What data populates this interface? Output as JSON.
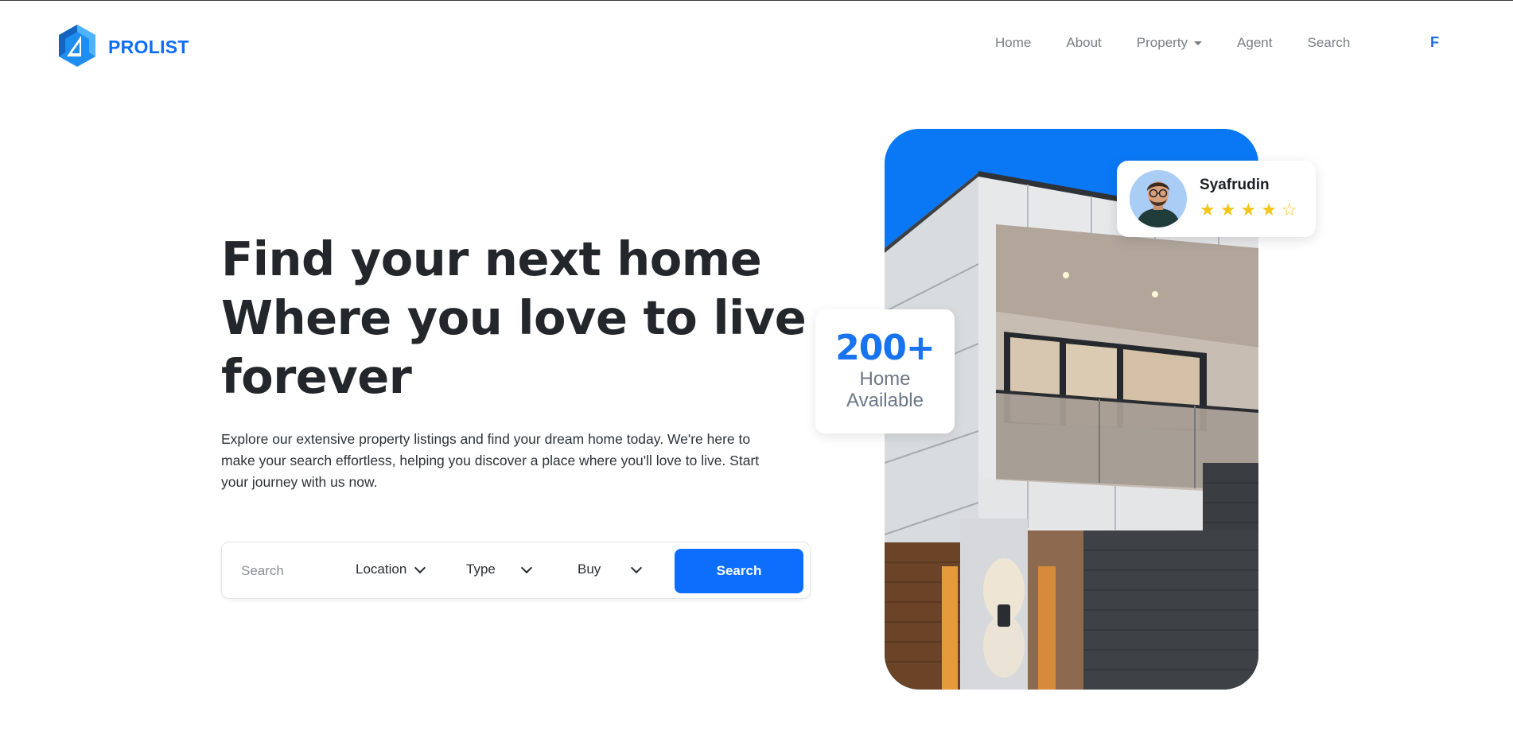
{
  "brand": {
    "name": "PROLIST",
    "logo_icon": "cube-logo-icon",
    "accent": "#0d6efd"
  },
  "nav": {
    "items": [
      "Home",
      "About",
      "Property",
      "Agent",
      "Search"
    ],
    "extra": "F"
  },
  "hero": {
    "title_lines": [
      "Find your next home",
      "Where you love to live",
      "forever"
    ],
    "description": "Explore our extensive property listings and find your dream home today. We're here to make your search effortless, helping you discover a place where you'll love to live. Start your journey with us now."
  },
  "search": {
    "placeholder": "Search",
    "location_label": "Location",
    "type_label": "Type",
    "buy_label": "Buy",
    "button_label": "Search"
  },
  "stat": {
    "value": "200+",
    "label_line1": "Home",
    "label_line2": "Available"
  },
  "agent": {
    "name": "Syafrudin",
    "rating": 4,
    "max_rating": 5
  },
  "colors": {
    "primary": "#0d6efd",
    "sky": "#0a78f5",
    "star": "#f5c518",
    "text_dark": "#23272b",
    "nav_text": "#7a7f85"
  }
}
